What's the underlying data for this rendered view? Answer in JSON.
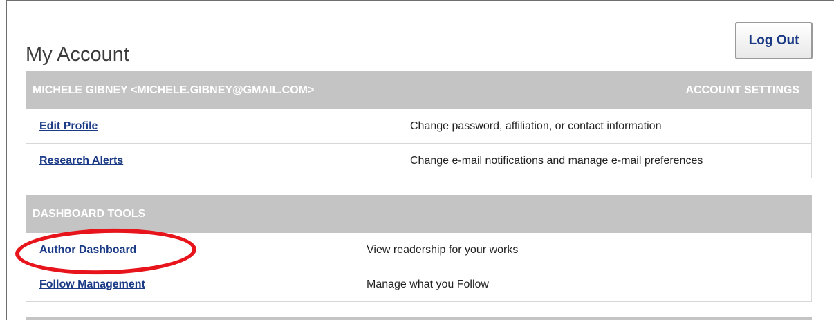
{
  "page": {
    "title": "My Account"
  },
  "header": {
    "logout_label": "Log Out"
  },
  "account": {
    "user_label": "MICHELE GIBNEY <MICHELE.GIBNEY@GMAIL.COM>",
    "section_title": "ACCOUNT SETTINGS",
    "rows": [
      {
        "link": "Edit Profile",
        "description": "Change password, affiliation, or contact information"
      },
      {
        "link": "Research Alerts",
        "description": "Change e-mail notifications and manage e-mail preferences"
      }
    ]
  },
  "dashboard": {
    "section_title": "DASHBOARD TOOLS",
    "rows": [
      {
        "link": "Author Dashboard",
        "description": "View readership for your works"
      },
      {
        "link": "Follow Management",
        "description": "Manage what you Follow"
      }
    ]
  },
  "annotation": {
    "color": "#e8141b"
  }
}
